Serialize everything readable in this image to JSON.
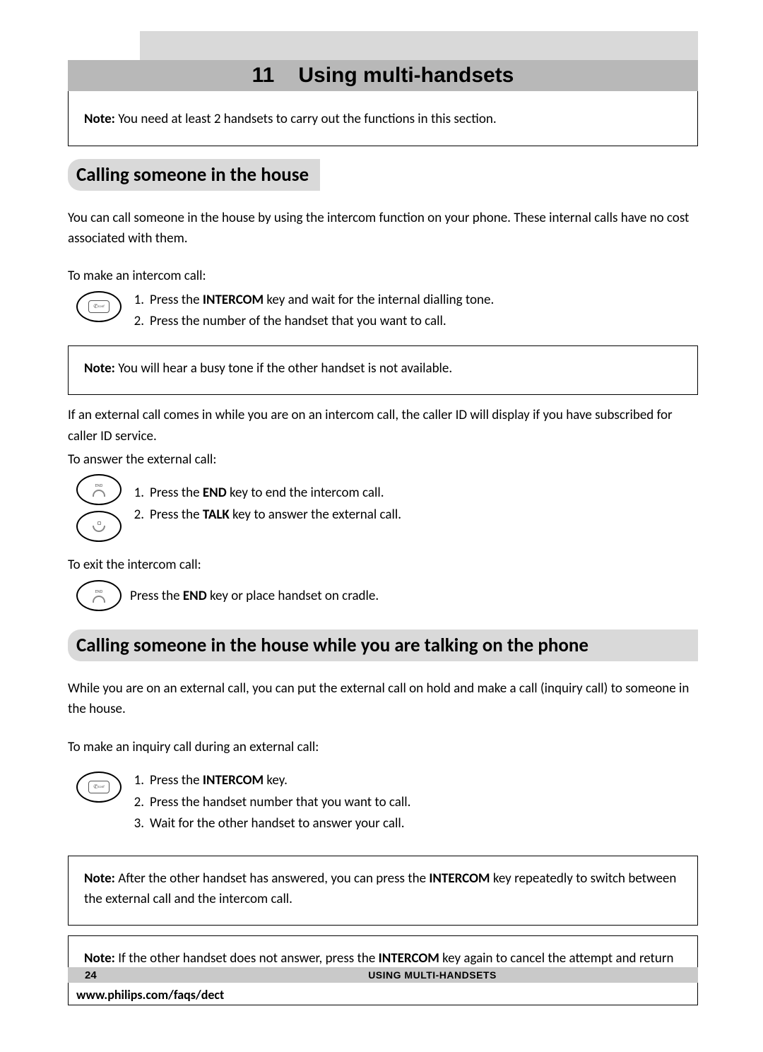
{
  "chapter": {
    "number": "11",
    "title": "Using multi-handsets"
  },
  "note_top": {
    "label": "Note:",
    "text": "You need at least 2 handsets to carry out the functions in this section."
  },
  "section1": {
    "heading": "Calling someone in the house",
    "intro": "You can call someone in the house by using the intercom function on your phone.  These internal calls have no cost associated with them.",
    "lead1": "To make an intercom call:",
    "step1_pre": "Press the ",
    "step1_key": "INTERCOM",
    "step1_post": " key and wait for the internal dialling tone.",
    "step2": "Press the number of the handset that you want to call.",
    "note_busy": {
      "label": "Note:",
      "text": " You will hear a busy tone if the other handset is not available."
    },
    "external_info": "If an external call comes in while you are on an intercom call, the caller ID will display if you have subscribed for caller ID service.",
    "lead2": "To answer the external call:",
    "ans1_pre": "Press the ",
    "ans1_key": "END",
    "ans1_post": " key to end the intercom call.",
    "ans2_pre": "Press the ",
    "ans2_key": "TALK",
    "ans2_post": " key to answer the external call.",
    "lead3": "To exit the intercom call:",
    "exit_pre": "Press the ",
    "exit_key": "END",
    "exit_post": " key or place handset on cradle."
  },
  "section2": {
    "heading": "Calling someone in the house while you are talking on the phone",
    "intro": "While you are on an external call, you can put the external call on hold and make a call (inquiry call) to someone in the house.",
    "lead": "To make an inquiry call during an external call:",
    "s1_pre": "Press the ",
    "s1_key": "INTERCOM",
    "s1_post": " key.",
    "s2": "Press the handset number that you want to call.",
    "s3": "Wait for the other handset to answer your call.",
    "note_switch": {
      "label": "Note:",
      "pre": " After the other handset has answered, you can press the ",
      "key": "INTERCOM",
      "post": " key repeatedly to switch between the external call and the intercom call."
    },
    "note_cancel": {
      "label": "Note:",
      "pre": " If the other handset does not answer, press the ",
      "key": "INTERCOM",
      "post": " key again to cancel the attempt and return to the external call."
    }
  },
  "footer": {
    "page": "24",
    "title": "USING MULTI-HANDSETS",
    "url": "www.philips.com/faqs/dect"
  },
  "icons": {
    "intercom": "intercom-key",
    "end": "end-key",
    "talk": "talk-key"
  }
}
